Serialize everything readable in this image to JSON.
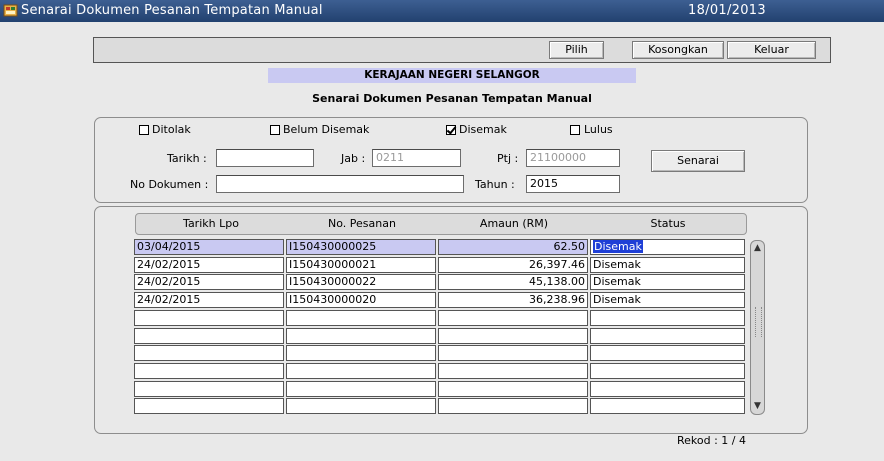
{
  "window": {
    "title": "Senarai Dokumen Pesanan Tempatan Manual",
    "date": "18/01/2013"
  },
  "toolbar": {
    "pilih": "Pilih",
    "kosongkan": "Kosongkan",
    "keluar": "Keluar"
  },
  "header": {
    "org": "KERAJAAN NEGERI SELANGOR",
    "subtitle": "Senarai Dokumen Pesanan Tempatan Manual"
  },
  "filters": {
    "ditolak": {
      "label": "Ditolak",
      "checked": false
    },
    "belum_disemak": {
      "label": "Belum Disemak",
      "checked": false
    },
    "disemak": {
      "label": "Disemak",
      "checked": true
    },
    "lulus": {
      "label": "Lulus",
      "checked": false
    },
    "tarikh_label": "Tarikh :",
    "tarikh_value": "",
    "jab_label": "Jab :",
    "jab_value": "0211",
    "ptj_label": "Ptj :",
    "ptj_value": "21100000",
    "no_dokumen_label": "No Dokumen :",
    "no_dokumen_value": "",
    "tahun_label": "Tahun :",
    "tahun_value": "2015",
    "senarai": "Senarai"
  },
  "table": {
    "headers": [
      "Tarikh Lpo",
      "No. Pesanan",
      "Amaun (RM)",
      "Status"
    ],
    "rows": [
      [
        "03/04/2015",
        "I150430000025",
        "62.50",
        "Disemak"
      ],
      [
        "24/02/2015",
        "I150430000021",
        "26,397.46",
        "Disemak"
      ],
      [
        "24/02/2015",
        "I150430000022",
        "45,138.00",
        "Disemak"
      ],
      [
        "24/02/2015",
        "I150430000020",
        "36,238.96",
        "Disemak"
      ],
      [
        "",
        "",
        "",
        ""
      ],
      [
        "",
        "",
        "",
        ""
      ],
      [
        "",
        "",
        "",
        ""
      ],
      [
        "",
        "",
        "",
        ""
      ],
      [
        "",
        "",
        "",
        ""
      ],
      [
        "",
        "",
        "",
        ""
      ]
    ]
  },
  "footer": {
    "rekod": "Rekod : 1 / 4"
  },
  "colors": {
    "titlebar": "#22416f",
    "header_band": "#c9c9f2",
    "selected_row": "#c9c9f2",
    "highlight": "#1f3fd6"
  },
  "icons": {
    "app": "app-icon",
    "scroll_up": "chevron-up-icon",
    "scroll_down": "chevron-down-icon"
  }
}
